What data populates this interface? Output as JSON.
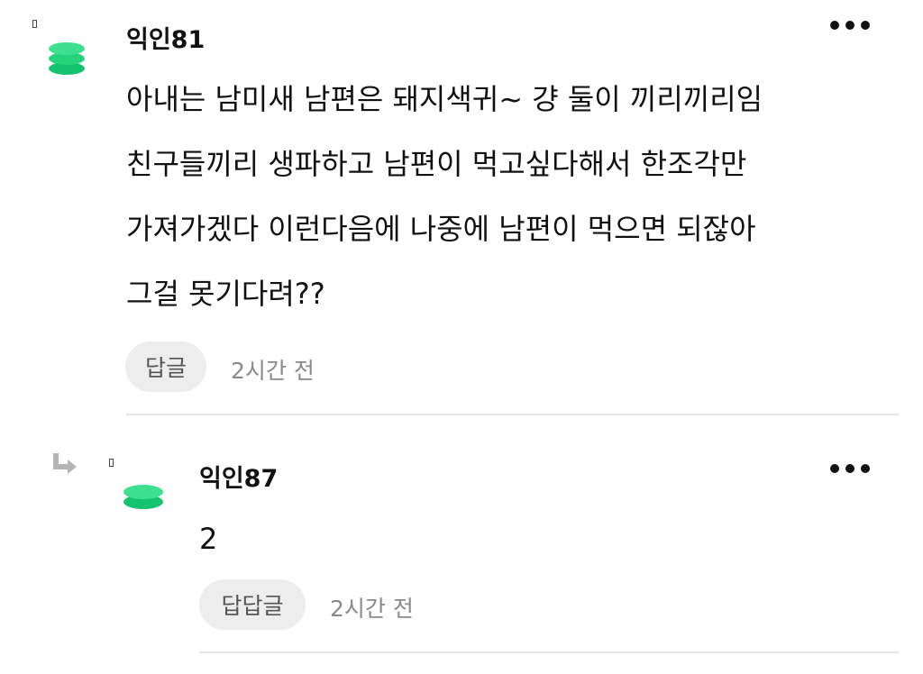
{
  "comment": {
    "author": "익인81",
    "lines": [
      "아내는 남미새 남편은 돼지색귀~ 걍 둘이 끼리끼리임",
      "친구들끼리 생파하고 남편이 먹고싶다해서 한조각만",
      "가져가겠다 이런다음에 나중에 남편이 먹으면 되잖아",
      "그걸 못기다려??"
    ],
    "reply_label": "답글",
    "time": "2시간 전",
    "avatar_icon": "green-stack-avatar-icon",
    "more_icon": "more-dots-icon"
  },
  "reply": {
    "author": "익인87",
    "text": "2",
    "reply_label": "답답글",
    "time": "2시간 전",
    "avatar_icon": "green-stack-avatar-icon",
    "reply_arrow_icon": "reply-arrow-icon",
    "more_icon": "more-dots-icon"
  },
  "colors": {
    "avatar_green_dark": "#15c36e",
    "avatar_green_light": "#3ee08f",
    "button_bg": "#ededed",
    "divider": "#e7e7e7",
    "muted_text": "#8a8a8a"
  }
}
